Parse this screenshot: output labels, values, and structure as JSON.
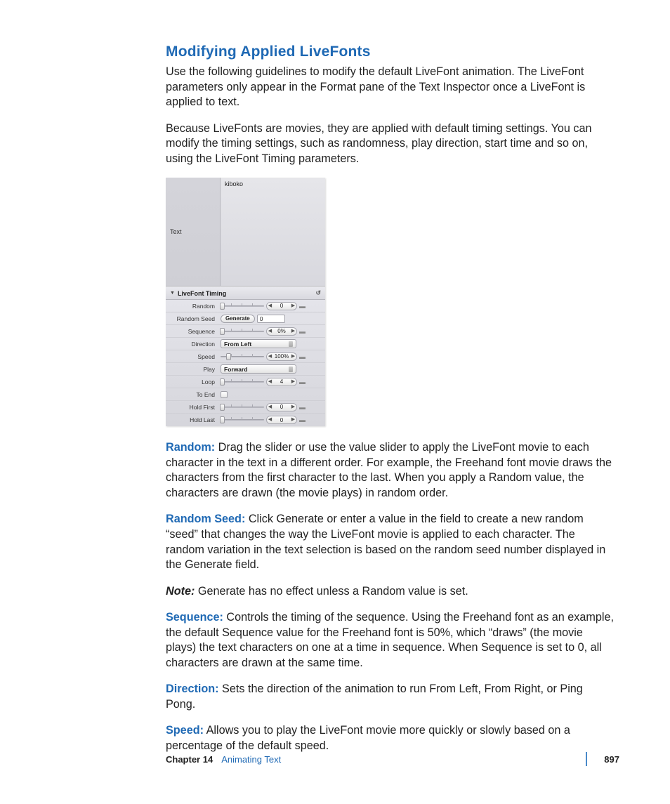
{
  "heading": "Modifying Applied LiveFonts",
  "intro1": "Use the following guidelines to modify the default LiveFont animation. The LiveFont parameters only appear in the Format pane of the Text Inspector once a LiveFont is applied to text.",
  "intro2": "Because LiveFonts are movies, they are applied with default timing settings. You can modify the timing settings, such as randomness, play direction, start time and so on, using the LiveFont Timing parameters.",
  "figure": {
    "text_label": "Text",
    "preview_text": "kiboko",
    "section_title": "LiveFont Timing",
    "reset_glyph": "↺",
    "params": {
      "random": {
        "label": "Random",
        "value": "0"
      },
      "random_seed": {
        "label": "Random Seed",
        "button": "Generate",
        "value": "0"
      },
      "sequence": {
        "label": "Sequence",
        "value": "0%"
      },
      "direction": {
        "label": "Direction",
        "value": "From Left"
      },
      "speed": {
        "label": "Speed",
        "value": "100%"
      },
      "play": {
        "label": "Play",
        "value": "Forward"
      },
      "loop": {
        "label": "Loop",
        "value": "4"
      },
      "to_end": {
        "label": "To End"
      },
      "hold_first": {
        "label": "Hold First",
        "value": "0"
      },
      "hold_last": {
        "label": "Hold Last",
        "value": "0"
      }
    }
  },
  "defs": {
    "random": {
      "term": "Random:",
      "text": "  Drag the slider or use the value slider to apply the LiveFont movie to each character in the text in a different order. For example, the Freehand font movie draws the characters from the first character to the last. When you apply a Random value, the characters are drawn (the movie plays) in random order."
    },
    "random_seed": {
      "term": "Random Seed:",
      "text": "  Click Generate or enter a value in the field to create a new random “seed” that changes the way the LiveFont movie is applied to each character. The random variation in the text selection is based on the random seed number displayed in the Generate field."
    },
    "note": {
      "term": "Note:",
      "text": "  Generate has no effect unless a Random value is set."
    },
    "sequence": {
      "term": "Sequence:",
      "text": "  Controls the timing of the sequence. Using the Freehand font as an example, the default Sequence value for the Freehand font is 50%, which “draws” (the movie plays) the text characters on one at a time in sequence. When Sequence is set to 0, all characters are drawn at the same time."
    },
    "direction": {
      "term": "Direction:",
      "text": "  Sets the direction of the animation to run From Left, From Right, or Ping Pong."
    },
    "speed": {
      "term": "Speed:",
      "text": "  Allows you to play the LiveFont movie more quickly or slowly based on a percentage of the default speed."
    }
  },
  "footer": {
    "chapter": "Chapter 14",
    "title": "Animating Text",
    "page": "897"
  }
}
